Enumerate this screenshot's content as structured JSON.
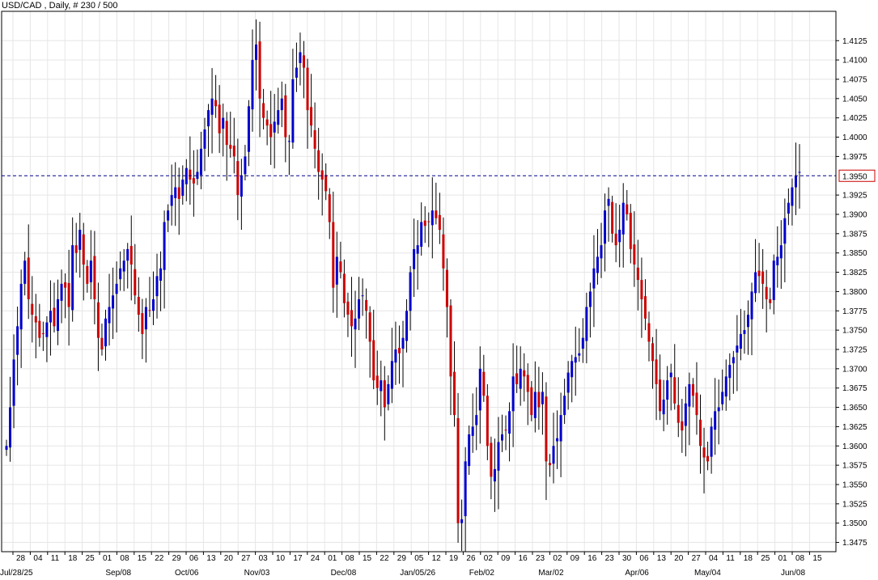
{
  "chart_data": {
    "type": "candlestick",
    "title": "USD/CAD , Daily, # 230 / 500",
    "ylim": [
      1.3463,
      1.4163
    ],
    "y_ticks": [
      "1.4125",
      "1.4100",
      "1.4075",
      "1.4050",
      "1.4025",
      "1.4000",
      "1.3975",
      "1.3925",
      "1.3900",
      "1.3875",
      "1.3850",
      "1.3825",
      "1.3800",
      "1.3775",
      "1.3750",
      "1.3725",
      "1.3700",
      "1.3675",
      "1.3650",
      "1.3625",
      "1.3600",
      "1.3575",
      "1.3550",
      "1.3525",
      "1.3500",
      "1.3475"
    ],
    "current_price": 1.395,
    "current_price_label": "1.3950",
    "day_labels": [
      "28",
      "04",
      "11",
      "18",
      "25",
      "01",
      "08",
      "15",
      "22",
      "29",
      "06",
      "13",
      "20",
      "27",
      "03",
      "10",
      "17",
      "24",
      "01",
      "08",
      "15",
      "22",
      "29",
      "05",
      "12",
      "19",
      "26",
      "02",
      "09",
      "16",
      "23",
      "02",
      "09",
      "16",
      "23",
      "30",
      "06",
      "13",
      "20",
      "27",
      "04",
      "11",
      "18",
      "25",
      "01",
      "08",
      "15"
    ],
    "month_labels": [
      "Jul/28/25",
      "Sep/08",
      "Oct/06",
      "Nov/03",
      "Dec/08",
      "Jan/05/26",
      "Feb/02",
      "Mar/02",
      "Apr/06",
      "May/04",
      "Jun/08"
    ],
    "colors": {
      "up": "#0000cc",
      "down": "#cc0000",
      "grid": "#e6e6e6",
      "current_line": "#00008b",
      "current_box": "#cc0000"
    },
    "grid": true,
    "closes": [
      1.36,
      1.365,
      1.3712,
      1.3755,
      1.381,
      1.384,
      1.379,
      1.377,
      1.376,
      1.374,
      1.3745,
      1.376,
      1.3775,
      1.3755,
      1.379,
      1.381,
      1.3805,
      1.378,
      1.386,
      1.385,
      1.388,
      1.3835,
      1.381,
      1.384,
      1.379,
      1.374,
      1.3725,
      1.3765,
      1.378,
      1.3795,
      1.381,
      1.383,
      1.384,
      1.3855,
      1.3835,
      1.3795,
      1.377,
      1.3745,
      1.378,
      1.3775,
      1.379,
      1.382,
      1.383,
      1.389,
      1.3905,
      1.3925,
      1.3935,
      1.392,
      1.3945,
      1.396,
      1.3945,
      1.394,
      1.3955,
      1.3985,
      1.401,
      1.4035,
      1.405,
      1.404,
      1.4005,
      1.4025,
      1.399,
      1.3985,
      1.3975,
      1.3925,
      1.395,
      1.3975,
      1.404,
      1.41,
      1.412,
      1.405,
      1.4025,
      1.4015,
      1.4,
      1.402,
      1.4035,
      1.405,
      1.4,
      1.3995,
      1.4075,
      1.409,
      1.411,
      1.409,
      1.4035,
      1.4015,
      1.3985,
      1.3955,
      1.3945,
      1.393,
      1.389,
      1.3805,
      1.3845,
      1.3825,
      1.3785,
      1.377,
      1.3755,
      1.3765,
      1.379,
      1.3795,
      1.3775,
      1.3735,
      1.3685,
      1.3675,
      1.3685,
      1.365,
      1.368,
      1.371,
      1.3725,
      1.372,
      1.374,
      1.3775,
      1.3825,
      1.3855,
      1.386,
      1.389,
      1.3885,
      1.389,
      1.3905,
      1.3895,
      1.388,
      1.383,
      1.378,
      1.369,
      1.364,
      1.35,
      1.3505,
      1.358,
      1.3615,
      1.3625,
      1.364,
      1.37,
      1.3665,
      1.36,
      1.356,
      1.357,
      1.3605,
      1.3615,
      1.362,
      1.3645,
      1.369,
      1.368,
      1.37,
      1.369,
      1.367,
      1.364,
      1.367,
      1.365,
      1.367,
      1.358,
      1.3575,
      1.36,
      1.361,
      1.364,
      1.3665,
      1.3695,
      1.371,
      1.3715,
      1.372,
      1.374,
      1.378,
      1.38,
      1.383,
      1.3845,
      1.386,
      1.3905,
      1.392,
      1.3875,
      1.386,
      1.388,
      1.3915,
      1.39,
      1.3855,
      1.3835,
      1.3815,
      1.379,
      1.3765,
      1.3735,
      1.371,
      1.368,
      1.3645,
      1.366,
      1.3685,
      1.3695,
      1.3655,
      1.363,
      1.362,
      1.3655,
      1.368,
      1.3665,
      1.364,
      1.36,
      1.3585,
      1.358,
      1.3625,
      1.3645,
      1.365,
      1.367,
      1.369,
      1.3705,
      1.3715,
      1.373,
      1.3745,
      1.375,
      1.377,
      1.38,
      1.3825,
      1.382,
      1.381,
      1.379,
      1.3785,
      1.384,
      1.3845,
      1.386,
      1.3895,
      1.3915,
      1.3935,
      1.395,
      1.3955
    ]
  }
}
